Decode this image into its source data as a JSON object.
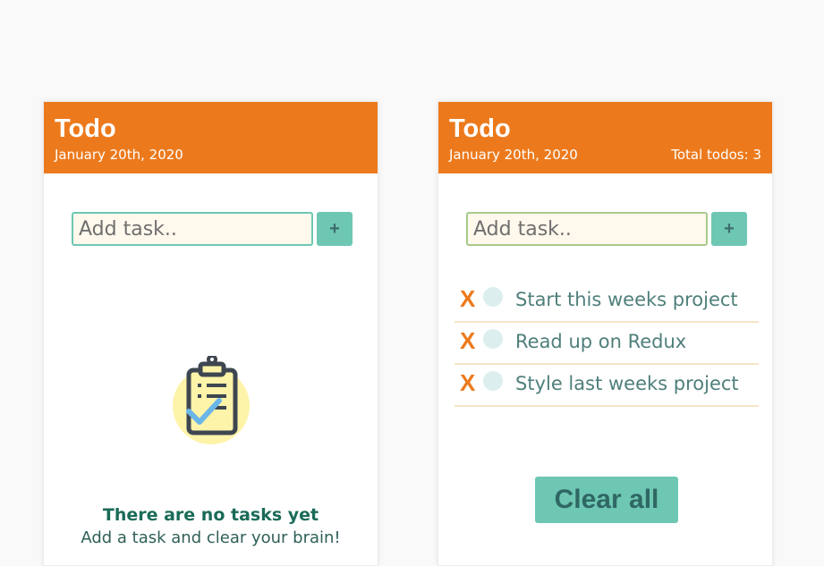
{
  "left_card": {
    "title": "Todo",
    "date": "January 20th, 2020",
    "input_placeholder": "Add task..",
    "add_label": "+",
    "empty_title": "There are no tasks yet",
    "empty_subtitle": "Add a task and clear your brain!"
  },
  "right_card": {
    "title": "Todo",
    "date": "January 20th, 2020",
    "total": "Total todos: 3",
    "input_placeholder": "Add task..",
    "add_label": "+",
    "delete_label": "X",
    "todos": [
      {
        "text": "Start this weeks project"
      },
      {
        "text": "Read up on Redux"
      },
      {
        "text": "Style last weeks project"
      }
    ],
    "clear_label": "Clear all"
  },
  "icons": {
    "empty_state": "clipboard-check-icon"
  },
  "colors": {
    "header": "#ec7a1d",
    "accent": "#6ec7b3",
    "delete": "#ec7a1d",
    "empty_title": "#1a6b58"
  }
}
